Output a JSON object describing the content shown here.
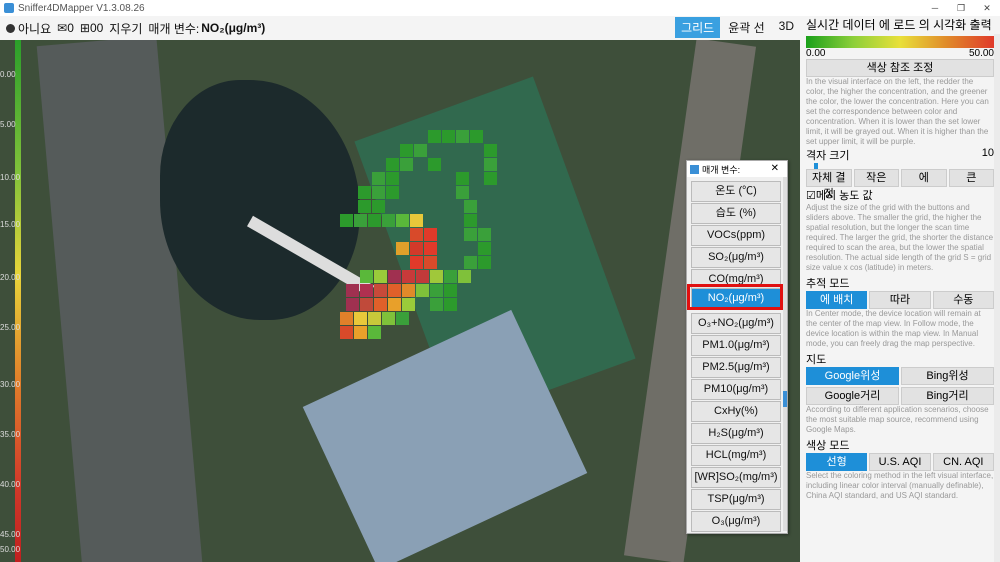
{
  "titlebar": {
    "title": "Sniffer4DMapper V1.3.08.26",
    "minimize": "─",
    "restore": "❐",
    "close": "✕"
  },
  "toolbar": {
    "items": [
      "아니요",
      "0",
      "00",
      "지우기",
      "매개 변수:"
    ],
    "param_value": "NO₂(μg/m³)",
    "right_buttons": [
      "그리드",
      "윤곽 선",
      "3D"
    ],
    "active": "그리드"
  },
  "scale_ticks": [
    "0.00",
    "5.00",
    "10.00",
    "15.00",
    "20.00",
    "25.00",
    "30.00",
    "35.00",
    "40.00",
    "45.00",
    "50.00"
  ],
  "popup": {
    "title": "매개 변수:",
    "close": "✕",
    "options": [
      "온도 (℃)",
      "습도 (%)",
      "VOCs(ppm)",
      "SO₂(μg/m³)",
      "CO(mg/m³)",
      "NO₂(μg/m³)",
      "O₃+NO₂(μg/m³)",
      "PM1.0(μg/m³)",
      "PM2.5(μg/m³)",
      "PM10(μg/m³)",
      "CxHy(%)",
      "H₂S(μg/m³)",
      "HCL(mg/m³)",
      "[WR]SO₂(mg/m³)",
      "TSP(μg/m³)",
      "O₃(μg/m³)"
    ],
    "selected": "NO₂(μg/m³)"
  },
  "panel": {
    "title": "실시간 데이터 에 로드 의 시각화 출력",
    "range_min": "0.00",
    "range_max": "50.00",
    "color_ref_button": "색상 참조 조정",
    "color_desc": "In the visual interface on the left, the redder the color, the higher the concentration, and the greener the color, the lower the concentration. Here you can set the correspondence between color and concentration. When it is lower than the set lower limit, it will be grayed out. When it is higher than the set upper limit, it will be purple.",
    "grid_size_label": "격자 크기",
    "grid_size_value": "10",
    "grid_buttons": [
      "자체 결정",
      "작은",
      "에",
      "큰"
    ],
    "mesh_label": "☑메시 농도 값",
    "grid_desc": "Adjust the size of the grid with the buttons and sliders above. The smaller the grid, the higher the spatial resolution, but the longer the scan time required. The larger the grid, the shorter the distance required to scan the area, but the lower the spatial resolution. The actual side length of the grid S = grid size value x cos (latitude) in meters.",
    "track_label": "추적 모드",
    "track_buttons": [
      "에 배치",
      "따라",
      "수동"
    ],
    "track_active": "에 배치",
    "track_desc": "In Center mode, the device location will remain at the center of the map view. In Follow mode, the device location is within the map view. In Manual mode, you can freely drag the map perspective.",
    "map_label": "지도",
    "map_buttons": [
      "Google위성",
      "Bing위성",
      "Google거리",
      "Bing거리"
    ],
    "map_active": "Google위성",
    "map_desc": "According to different application scenarios, choose the most suitable map source, recommend using Google Maps.",
    "color_mode_label": "색상 모드",
    "color_mode_buttons": [
      "선형",
      "U.S. AQI",
      "CN. AQI"
    ],
    "color_mode_active": "선형",
    "color_mode_desc": "Select the coloring method in the left visual interface, including linear color interval (manually definable), China AQI standard, and US AQI standard."
  }
}
